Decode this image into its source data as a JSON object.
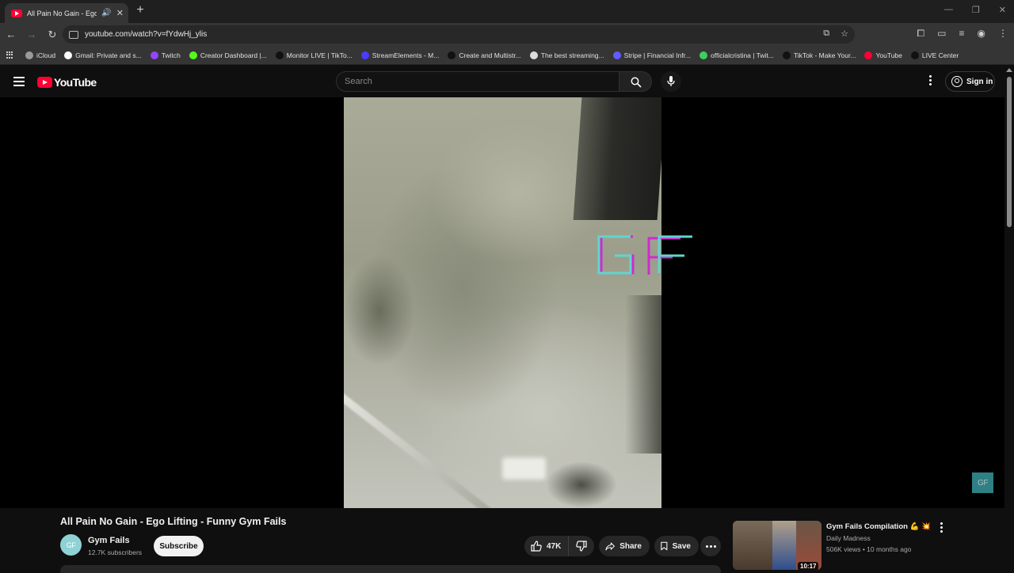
{
  "browser": {
    "tab": {
      "title": "All Pain No Gain - Ego Lifting",
      "favicon": "youtube-icon",
      "audio_icon": "speaker-icon"
    },
    "address_bar": {
      "url": "youtube.com/watch?v=fYdwHj_ylis"
    },
    "bookmarks": [
      {
        "label": "iCloud",
        "icon": "apple-icon",
        "color": "#9a9a9a"
      },
      {
        "label": "Gmail: Private and s...",
        "icon": "google-icon",
        "color": "#ffffff"
      },
      {
        "label": "Twitch",
        "icon": "twitch-icon",
        "color": "#9146ff"
      },
      {
        "label": "Creator Dashboard |...",
        "icon": "kick-icon",
        "color": "#53fc18"
      },
      {
        "label": "Monitor LIVE | TikTo...",
        "icon": "tiktok-icon",
        "color": "#111111"
      },
      {
        "label": "StreamElements - M...",
        "icon": "streamelements-icon",
        "color": "#4a3cff"
      },
      {
        "label": "Create and Multistr...",
        "icon": "restream-icon",
        "color": "#111111"
      },
      {
        "label": "The best streaming...",
        "icon": "diamond-icon",
        "color": "#dddddd"
      },
      {
        "label": "Stripe | Financial Infr...",
        "icon": "stripe-icon",
        "color": "#635bff"
      },
      {
        "label": "officialcristina | Twit...",
        "icon": "twitch-green-icon",
        "color": "#3fcf5f"
      },
      {
        "label": "TikTok - Make Your...",
        "icon": "tiktok-icon",
        "color": "#111111"
      },
      {
        "label": "YouTube",
        "icon": "youtube-icon",
        "color": "#ff0033"
      },
      {
        "label": "LIVE Center",
        "icon": "tiktok-icon",
        "color": "#111111"
      }
    ]
  },
  "youtube": {
    "logo_text": "YouTube",
    "search": {
      "placeholder": "Search"
    },
    "signin_label": "Sign in",
    "player_watermark": "GF",
    "corner_watermark": "GF",
    "video": {
      "title": "All Pain No Gain - Ego Lifting - Funny Gym Fails",
      "channel": {
        "name": "Gym Fails",
        "subscribers": "12.7K subscribers",
        "avatar_text": "GF"
      },
      "subscribe_label": "Subscribe",
      "likes": "47K",
      "share_label": "Share",
      "save_label": "Save"
    },
    "recommendation": {
      "title": "Gym Fails Compilation 💪 💥",
      "channel": "Daily Madness",
      "meta": "506K views • 10 months ago",
      "duration": "10:17"
    },
    "colors": {
      "brand_red": "#ff0033",
      "background": "#0f0f0f",
      "watermark_teal": "#5fd6d0",
      "watermark_magenta": "#d02ad0"
    }
  }
}
